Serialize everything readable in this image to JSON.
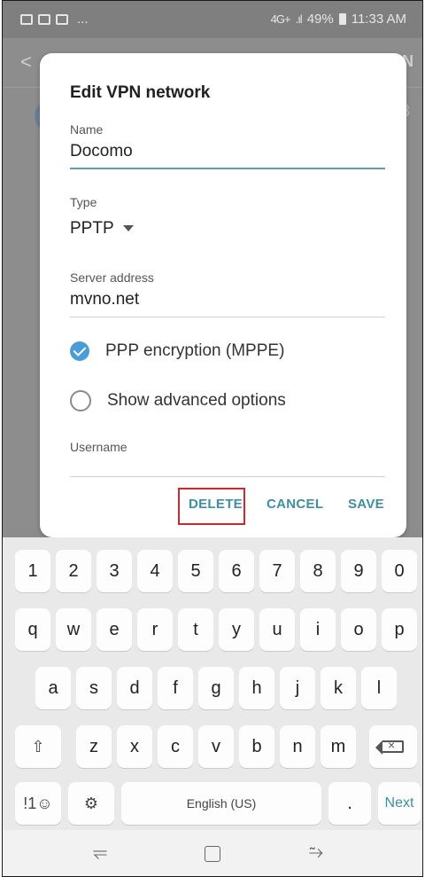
{
  "status_bar": {
    "left_icons": [
      "image-icon",
      "gallery-icon",
      "video-icon"
    ],
    "left_more": "...",
    "network": "4G+",
    "battery": "49%",
    "time": "11:33 AM"
  },
  "background_app": {
    "back_glyph": "<",
    "right_text": "N",
    "number": "3"
  },
  "dialog": {
    "title": "Edit VPN network",
    "name_label": "Name",
    "name_value": "Docomo",
    "type_label": "Type",
    "type_value": "PPTP",
    "server_label": "Server address",
    "server_value": "mvno.net",
    "ppp_label": "PPP encryption (MPPE)",
    "ppp_checked": true,
    "advanced_label": "Show advanced options",
    "advanced_checked": false,
    "username_label": "Username",
    "buttons": {
      "delete": "DELETE",
      "cancel": "CANCEL",
      "save": "SAVE"
    },
    "accent_color": "#3d8ea6",
    "highlight_color": "#d0272e"
  },
  "keyboard": {
    "row1": [
      "1",
      "2",
      "3",
      "4",
      "5",
      "6",
      "7",
      "8",
      "9",
      "0"
    ],
    "row2": [
      "q",
      "w",
      "e",
      "r",
      "t",
      "y",
      "u",
      "i",
      "o",
      "p"
    ],
    "row3": [
      "a",
      "s",
      "d",
      "f",
      "g",
      "h",
      "j",
      "k",
      "l"
    ],
    "row4": [
      "z",
      "x",
      "c",
      "v",
      "b",
      "n",
      "m"
    ],
    "symbols": "!1☺",
    "language": "English (US)",
    "period": ".",
    "next": "Next"
  },
  "nav_bar": {
    "recents_glyph": "⥫",
    "back_glyph": "⥲"
  }
}
